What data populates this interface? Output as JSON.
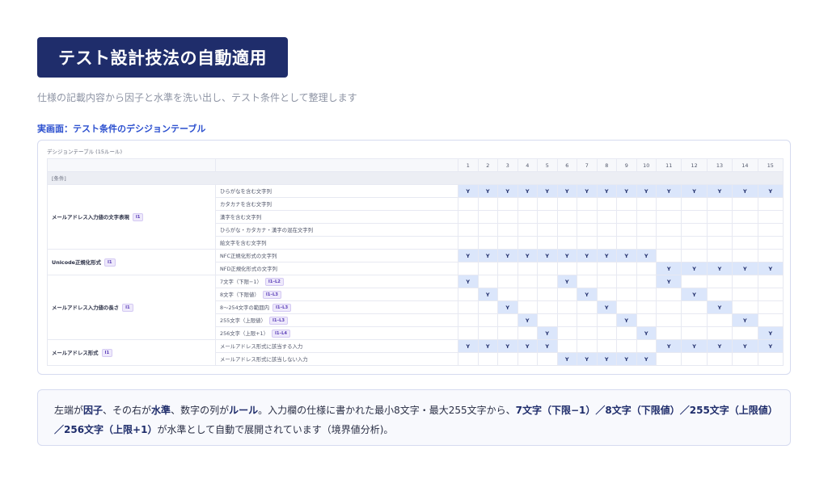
{
  "header": {
    "title": "テスト設計技法の自動適用"
  },
  "subtitle": "仕様の記載内容から因子と水準を洗い出し、テスト条件として整理します",
  "section_label": "実画面：テスト条件のデシジョンテーブル",
  "table": {
    "caption": "デシジョンテーブル (15ルール)",
    "rule_numbers": [
      "1",
      "2",
      "3",
      "4",
      "5",
      "6",
      "7",
      "8",
      "9",
      "10",
      "11",
      "12",
      "13",
      "14",
      "15"
    ],
    "section_conditions": "[条件]",
    "groups": [
      {
        "factor": "メールアドレス入力値の文字表現",
        "badge": "I1",
        "levels": [
          {
            "label": "ひらがなを含む文字列",
            "badge": "",
            "cells": [
              1,
              1,
              1,
              1,
              1,
              1,
              1,
              1,
              1,
              1,
              1,
              1,
              1,
              1,
              1
            ]
          },
          {
            "label": "カタカナを含む文字列",
            "badge": "",
            "cells": [
              0,
              0,
              0,
              0,
              0,
              0,
              0,
              0,
              0,
              0,
              0,
              0,
              0,
              0,
              0
            ]
          },
          {
            "label": "漢字を含む文字列",
            "badge": "",
            "cells": [
              0,
              0,
              0,
              0,
              0,
              0,
              0,
              0,
              0,
              0,
              0,
              0,
              0,
              0,
              0
            ]
          },
          {
            "label": "ひらがな・カタカナ・漢字の混在文字列",
            "badge": "",
            "cells": [
              0,
              0,
              0,
              0,
              0,
              0,
              0,
              0,
              0,
              0,
              0,
              0,
              0,
              0,
              0
            ]
          },
          {
            "label": "絵文字を含む文字列",
            "badge": "",
            "cells": [
              0,
              0,
              0,
              0,
              0,
              0,
              0,
              0,
              0,
              0,
              0,
              0,
              0,
              0,
              0
            ]
          }
        ]
      },
      {
        "factor": "Unicode正規化形式",
        "badge": "I1",
        "levels": [
          {
            "label": "NFC正規化形式の文字列",
            "badge": "",
            "cells": [
              1,
              1,
              1,
              1,
              1,
              1,
              1,
              1,
              1,
              1,
              0,
              0,
              0,
              0,
              0
            ]
          },
          {
            "label": "NFD正規化形式の文字列",
            "badge": "",
            "cells": [
              0,
              0,
              0,
              0,
              0,
              0,
              0,
              0,
              0,
              0,
              1,
              1,
              1,
              1,
              1
            ]
          }
        ]
      },
      {
        "factor": "メールアドレス入力値の長さ",
        "badge": "I1",
        "levels": [
          {
            "label": "7文字（下限−1）",
            "badge": "I1–L2",
            "cells": [
              1,
              0,
              0,
              0,
              0,
              1,
              0,
              0,
              0,
              0,
              1,
              0,
              0,
              0,
              0
            ]
          },
          {
            "label": "8文字（下限値）",
            "badge": "I1–L3",
            "cells": [
              0,
              1,
              0,
              0,
              0,
              0,
              1,
              0,
              0,
              0,
              0,
              1,
              0,
              0,
              0
            ]
          },
          {
            "label": "8〜254文字の範囲内",
            "badge": "I1–L3",
            "cells": [
              0,
              0,
              1,
              0,
              0,
              0,
              0,
              1,
              0,
              0,
              0,
              0,
              1,
              0,
              0
            ]
          },
          {
            "label": "255文字（上限値）",
            "badge": "I1–L3",
            "cells": [
              0,
              0,
              0,
              1,
              0,
              0,
              0,
              0,
              1,
              0,
              0,
              0,
              0,
              1,
              0
            ]
          },
          {
            "label": "256文字（上限+1）",
            "badge": "I1–L4",
            "cells": [
              0,
              0,
              0,
              0,
              1,
              0,
              0,
              0,
              0,
              1,
              0,
              0,
              0,
              0,
              1
            ]
          }
        ]
      },
      {
        "factor": "メールアドレス形式",
        "badge": "I1",
        "levels": [
          {
            "label": "メールアドレス形式に該当する入力",
            "badge": "",
            "cells": [
              1,
              1,
              1,
              1,
              1,
              0,
              0,
              0,
              0,
              0,
              1,
              1,
              1,
              1,
              1
            ]
          },
          {
            "label": "メールアドレス形式に該当しない入力",
            "badge": "",
            "cells": [
              0,
              0,
              0,
              0,
              0,
              1,
              1,
              1,
              1,
              1,
              0,
              0,
              0,
              0,
              0
            ]
          }
        ]
      }
    ],
    "yes_mark": "Y"
  },
  "note": {
    "t1": "左端が",
    "b1": "因子",
    "t2": "、その右が",
    "b2": "水準",
    "t3": "、数字の列が",
    "b3": "ルール",
    "t4": "。入力欄の仕様に書かれた最小8文字・最大255文字から、",
    "b4": "7文字（下限−1）／8文字（下限値）／255文字（上限値）／256文字（上限+1）",
    "t5": "が水準として自動で展開されています（境界値分析)。"
  },
  "colors": {
    "title_bg": "#1f2d6b",
    "accent": "#2b4fcf",
    "cell_on": "#dbe6fb"
  }
}
